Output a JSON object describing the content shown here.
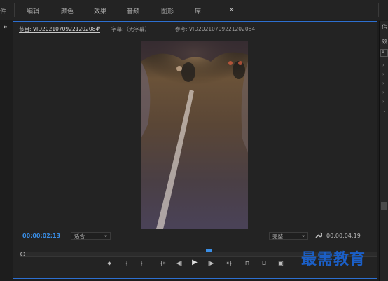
{
  "workspace": {
    "items": [
      "件",
      "编辑",
      "颜色",
      "效果",
      "音频",
      "图形",
      "库"
    ],
    "more": "»"
  },
  "panel": {
    "expand": "»",
    "program_tab": "节目: VID20210709221202084",
    "program_menu": "≡",
    "caption_tab": "字幕:（无字幕）",
    "reference_tab": "参考: VID20210709221202084"
  },
  "controls": {
    "current_time": "00:00:02:13",
    "zoom_select": "适合",
    "quality_select": "完整",
    "duration": "00:00:04:19",
    "accent_color": "#3a8ee6",
    "playhead_fraction": 0.53
  },
  "transport": {
    "add_marker": "⬥",
    "mark_in": "{",
    "mark_out": "}",
    "go_to_in": "{⇤",
    "step_back": "◀|",
    "play": "▶",
    "step_forward": "|▶",
    "go_to_out": "⇥}",
    "lift": "⊓",
    "extract": "⊔",
    "export_frame": "▣"
  },
  "right_panel": {
    "title_partial": "信",
    "subtitle_partial": "效",
    "search_icon": "search-icon"
  },
  "watermark": "最需教育"
}
